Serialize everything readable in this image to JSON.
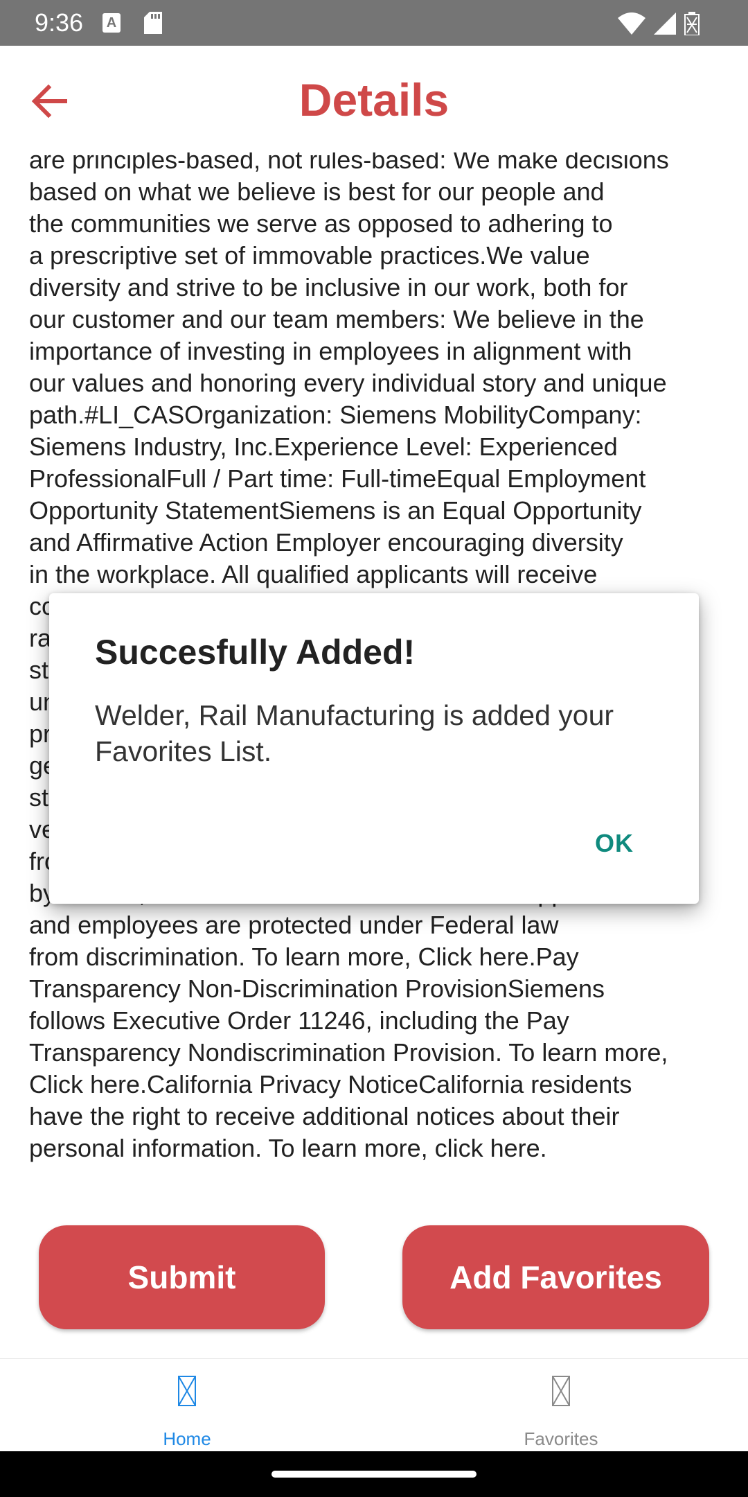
{
  "status_bar": {
    "time": "9:36",
    "a_icon": "A"
  },
  "header": {
    "title": "Details",
    "back_icon": "arrow-left-icon"
  },
  "main": {
    "description": "are principles-based, not rules-based: We make decisions\nbased on what we believe is best for our people and\nthe communities we serve as opposed to adhering to\na prescriptive set of immovable practices.We value\ndiversity and strive to be inclusive in our work, both for\nour customer and our team members: We believe in the\nimportance of investing in employees in alignment with\nour values and honoring every individual story and unique\npath.#LI_CASOrganization: Siemens MobilityCompany:\nSiemens Industry, Inc.Experience Level: Experienced\nProfessionalFull / Part time: Full-timeEqual Employment\nOpportunity StatementSiemens is an Equal Opportunity\nand Affirmative Action Employer encouraging diversity\nin the workplace. All qualified applicants will receive\nconsideration for employment without regard to their\nrace, color, creed, religion, national origin, citizenship\nstatus, ancestry, sex, age, physical or mental disability\nunrelated to ability, marital status, family responsibilities,\npregnancy, genetic information, sexual orientation,\ngender expression, gender identity, transgender, sex\nstereotyping, order of protection status, protected\nveteran or military status, or an unfavorable discharge\nfrom military service, and other categories protected\nby federal, state or local law.EEO is the Law Applicants\nand employees are protected under Federal law\nfrom discrimination. To learn more, Click here.Pay\nTransparency Non-Discrimination ProvisionSiemens\nfollows Executive Order 11246, including the Pay\nTransparency Nondiscrimination Provision. To learn more,\nClick here.California Privacy NoticeCalifornia residents\nhave the right to receive additional notices about their\npersonal information. To learn more, click here.",
    "submit_label": "Submit",
    "add_favorites_label": "Add Favorites"
  },
  "bottom_nav": {
    "items": [
      {
        "label": "Home",
        "icon": "home-icon",
        "active": true
      },
      {
        "label": "Favorites",
        "icon": "favorites-icon",
        "active": false
      }
    ]
  },
  "dialog": {
    "title": "Succesfully Added!",
    "message": "Welder, Rail Manufacturing is added your Favorites List.",
    "ok_label": "OK"
  },
  "colors": {
    "accent": "#cf4848",
    "button": "#d24a4e",
    "nav_active": "#1e88e5",
    "dialog_action": "#0f8a7e"
  }
}
